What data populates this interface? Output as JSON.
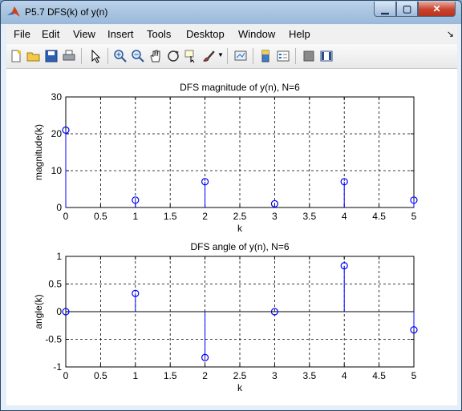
{
  "window": {
    "title": "P5.7 DFS(k) of y(n)"
  },
  "menu": [
    "File",
    "Edit",
    "View",
    "Insert",
    "Tools",
    "Desktop",
    "Window",
    "Help"
  ],
  "toolbar_icons": [
    "new-figure-icon",
    "open-file-icon",
    "save-icon",
    "print-icon",
    "pointer-icon",
    "zoom-in-icon",
    "zoom-out-icon",
    "pan-icon",
    "rotate-3d-icon",
    "data-cursor-icon",
    "brush-icon",
    "link-plot-icon",
    "colorbar-icon",
    "legend-icon",
    "hide-plot-tools-icon",
    "show-plot-tools-icon"
  ],
  "colors": {
    "stem": "#0000ff",
    "accent": "#d0421c"
  },
  "chart_data": [
    {
      "type": "stem",
      "title": "DFS magnitude of y(n), N=6",
      "xlabel": "k",
      "ylabel": "magnitude(k)",
      "x": [
        0,
        1,
        2,
        3,
        4,
        5
      ],
      "y": [
        21,
        2,
        7,
        1,
        7,
        2
      ],
      "xlim": [
        0,
        5
      ],
      "ylim": [
        0,
        30
      ],
      "xticks": [
        "0",
        "0.5",
        "1",
        "1.5",
        "2",
        "2.5",
        "3",
        "3.5",
        "4",
        "4.5",
        "5"
      ],
      "yticks": [
        "0",
        "10",
        "20",
        "30"
      ],
      "grid": true
    },
    {
      "type": "stem",
      "title": "DFS angle of y(n), N=6",
      "xlabel": "k",
      "ylabel": "angle(k)",
      "x": [
        0,
        1,
        2,
        3,
        4,
        5
      ],
      "y": [
        0,
        0.33,
        -0.83,
        0,
        0.83,
        -0.33
      ],
      "xlim": [
        0,
        5
      ],
      "ylim": [
        -1,
        1
      ],
      "xticks": [
        "0",
        "0.5",
        "1",
        "1.5",
        "2",
        "2.5",
        "3",
        "3.5",
        "4",
        "4.5",
        "5"
      ],
      "yticks": [
        "-1",
        "-0.5",
        "0",
        "0.5",
        "1"
      ],
      "grid": true
    }
  ]
}
